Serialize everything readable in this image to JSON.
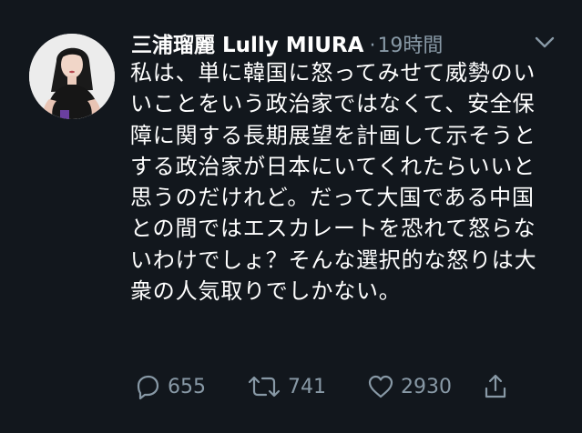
{
  "tweet": {
    "author_name": "三浦瑠麗 Lully MIURA",
    "separator": "·",
    "time": "19時間",
    "text": "私は、単に韓国に怒ってみせて威勢のいいことをいう政治家ではなくて、安全保障に関する長期展望を計画して示そうとする政治家が日本にいてくれたらいいと思うのだけれど。だって大国である中国との間ではエスカレートを恐れて怒らないわけでしょ？そんな選択的な怒りは大衆の人気取りでしかない。",
    "actions": {
      "reply_count": "655",
      "retweet_count": "741",
      "like_count": "2930"
    }
  },
  "colors": {
    "background": "#12171d",
    "text_primary": "#ffffff",
    "text_secondary": "#8899a6"
  },
  "icons": {
    "reply": "reply-icon",
    "retweet": "retweet-icon",
    "like": "heart-icon",
    "share": "share-icon",
    "menu": "chevron-down-icon"
  }
}
